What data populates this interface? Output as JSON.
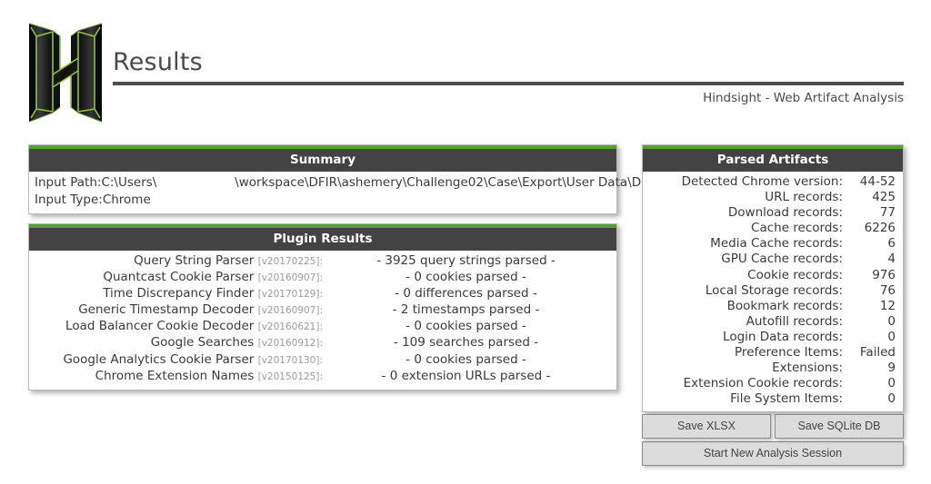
{
  "header": {
    "logo_alt": "hindsight-logo",
    "title": "Results",
    "subtitle": "Hindsight - Web Artifact Analysis"
  },
  "summary": {
    "heading": "Summary",
    "rows": [
      {
        "label": "Input Path:",
        "value": "C:\\Users\\                    \\workspace\\DFIR\\ashemery\\Challenge02\\Case\\Export\\User Data\\Default"
      },
      {
        "label": "Input Type:",
        "value": "Chrome"
      }
    ]
  },
  "plugin_results": {
    "heading": "Plugin Results",
    "rows": [
      {
        "name": "Query String Parser",
        "version": "[v20170225]:",
        "result": "- 3925 query strings parsed -"
      },
      {
        "name": "Quantcast Cookie Parser",
        "version": "[v20160907]:",
        "result": "- 0 cookies parsed -"
      },
      {
        "name": "Time Discrepancy Finder",
        "version": "[v20170129]:",
        "result": "- 0 differences parsed -"
      },
      {
        "name": "Generic Timestamp Decoder",
        "version": "[v20160907]:",
        "result": "- 2 timestamps parsed -"
      },
      {
        "name": "Load Balancer Cookie Decoder",
        "version": "[v20160621]:",
        "result": "- 0 cookies parsed -"
      },
      {
        "name": "Google Searches",
        "version": "[v20160912]:",
        "result": "- 109 searches parsed -"
      },
      {
        "name": "Google Analytics Cookie Parser",
        "version": "[v20170130]:",
        "result": "- 0 cookies parsed -"
      },
      {
        "name": "Chrome Extension Names",
        "version": "[v20150125]:",
        "result": "- 0 extension URLs parsed -"
      }
    ]
  },
  "parsed_artifacts": {
    "heading": "Parsed Artifacts",
    "rows": [
      {
        "label": "Detected Chrome version:",
        "value": "44-52"
      },
      {
        "label": "URL records:",
        "value": "425"
      },
      {
        "label": "Download records:",
        "value": "77"
      },
      {
        "label": "Cache records:",
        "value": "6226"
      },
      {
        "label": "Media Cache records:",
        "value": "6"
      },
      {
        "label": "GPU Cache records:",
        "value": "4"
      },
      {
        "label": "Cookie records:",
        "value": "976"
      },
      {
        "label": "Local Storage records:",
        "value": "76"
      },
      {
        "label": "Bookmark records:",
        "value": "12"
      },
      {
        "label": "Autofill records:",
        "value": "0"
      },
      {
        "label": "Login Data records:",
        "value": "0"
      },
      {
        "label": "Preference Items:",
        "value": "Failed"
      },
      {
        "label": "Extensions:",
        "value": "9"
      },
      {
        "label": "Extension Cookie records:",
        "value": "0"
      },
      {
        "label": "File System Items:",
        "value": "0"
      }
    ]
  },
  "buttons": {
    "save_xlsx": "Save XLSX",
    "save_sqlite": "Save SQLite DB",
    "new_session": "Start New Analysis Session"
  },
  "colors": {
    "accent_green": "#56a033",
    "panel_header": "#434343",
    "page_background": "#ffffff",
    "text": "#3a3a3a",
    "muted_text": "#9b9b9b",
    "button_face": "#dcdcdc"
  }
}
